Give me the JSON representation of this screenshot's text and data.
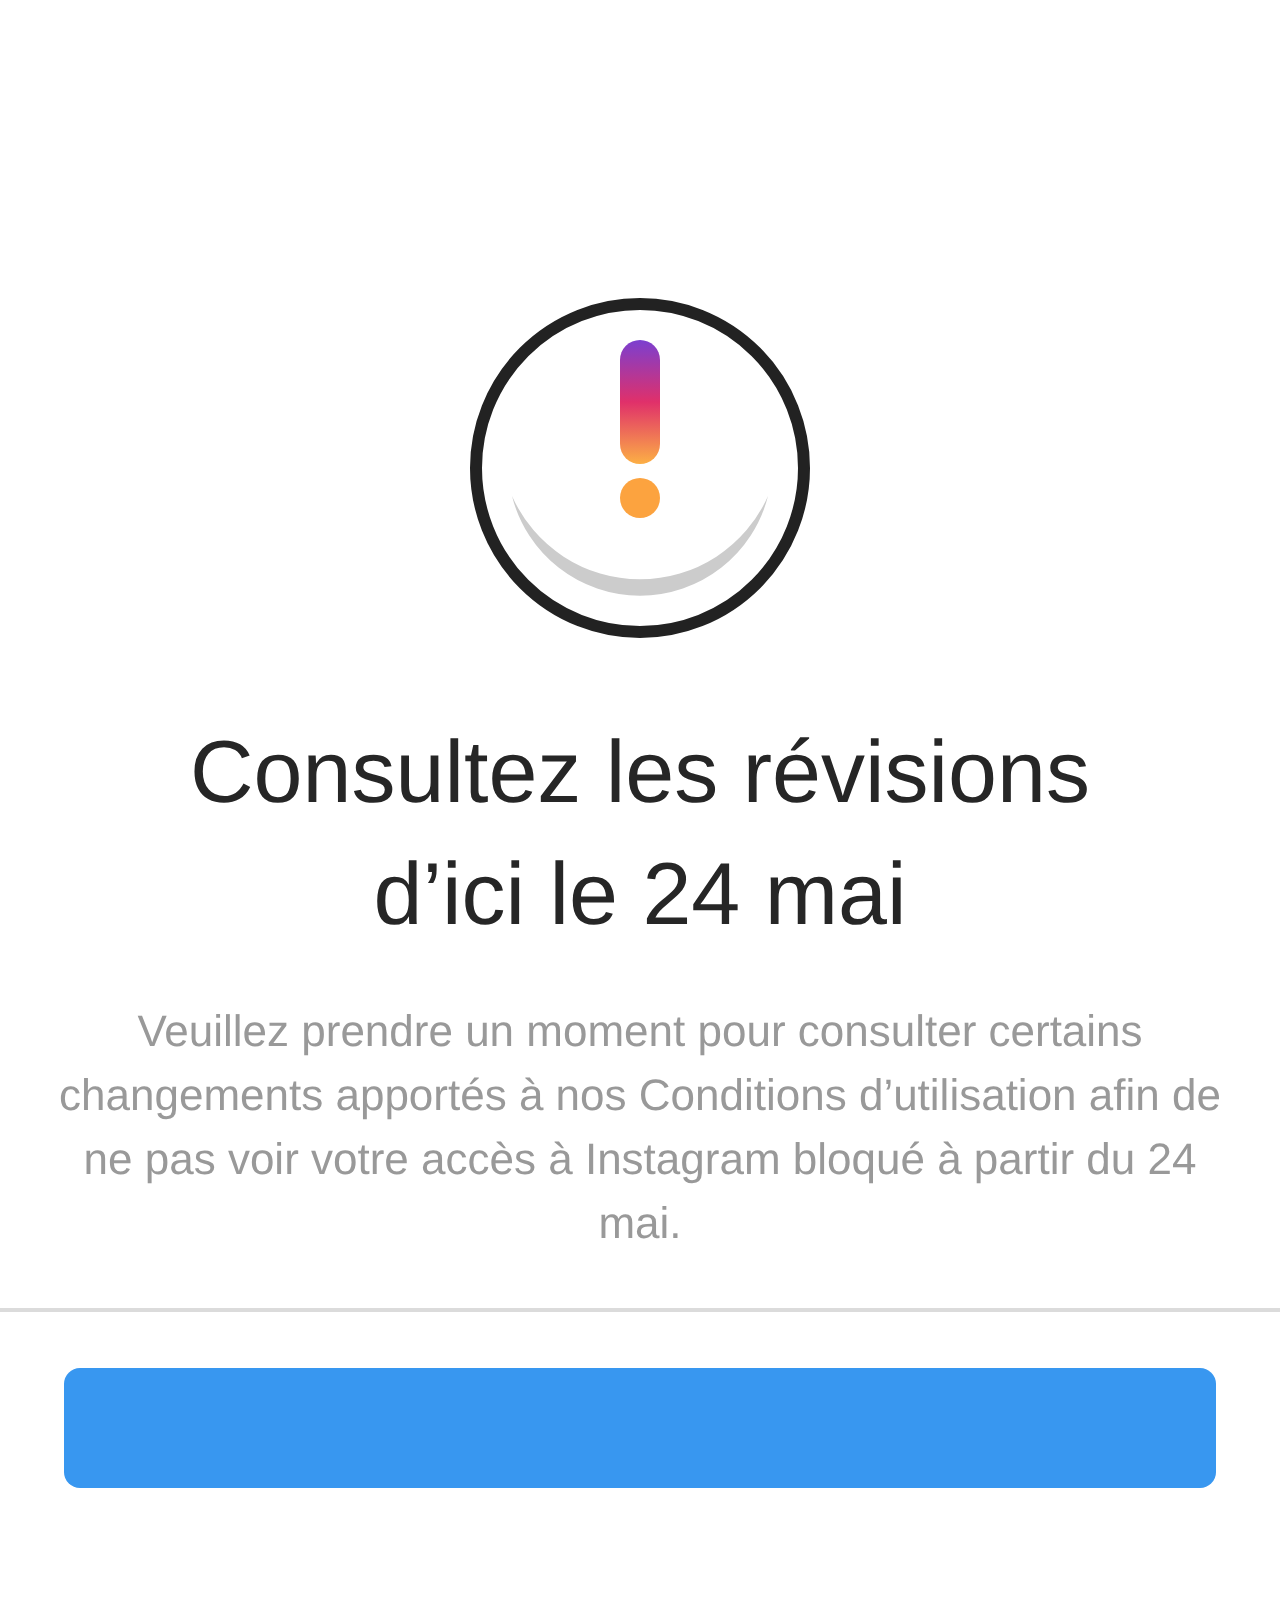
{
  "title": "Consultez les révisions d’ici le 24 mai",
  "message": "Veuillez prendre un moment pour consulter certains changements apportés à nos Conditions d’utilisation afin de ne pas voir votre accès à Instagram bloqué à partir du 24 mai.",
  "button": {
    "kind": "primary"
  }
}
